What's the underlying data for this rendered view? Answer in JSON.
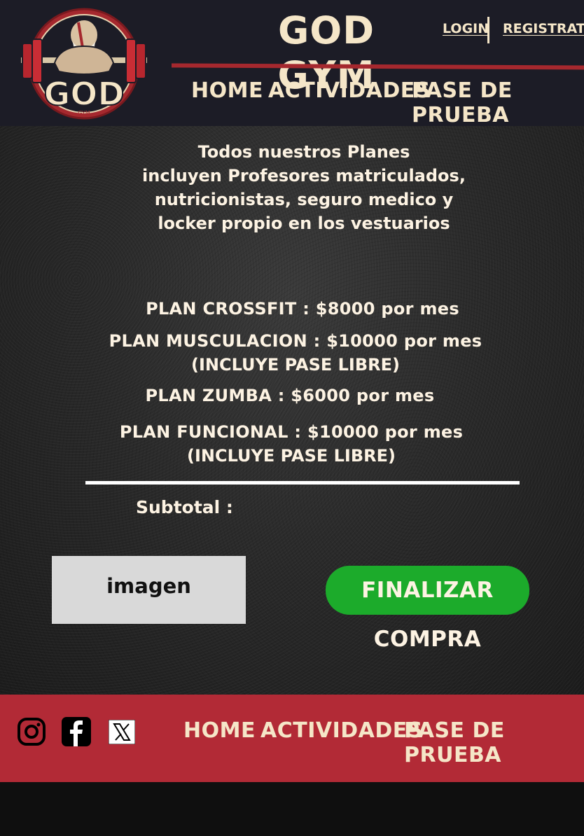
{
  "header": {
    "title": "GOD GYM",
    "logo_text": "GOD",
    "logo_subtext": "GYM",
    "login_label": "LOGIN",
    "register_label": "REGISTRATE",
    "nav": [
      {
        "label": "HOME"
      },
      {
        "label": "ACTIVIDADES"
      },
      {
        "label": "PASE DE PRUEBA"
      }
    ]
  },
  "main": {
    "intro_lines": [
      "Todos nuestros Planes",
      "incluyen Profesores matriculados,",
      "nutricionistas, seguro medico y",
      "locker propio en los vestuarios"
    ],
    "plans": [
      {
        "line1": "PLAN CROSSFIT : $8000 por mes",
        "line2": ""
      },
      {
        "line1": "PLAN MUSCULACION : $10000 por mes",
        "line2": "(INCLUYE PASE LIBRE)"
      },
      {
        "line1": "PLAN ZUMBA : $6000 por mes",
        "line2": ""
      },
      {
        "line1": "PLAN FUNCIONAL : $10000 por mes",
        "line2": "(INCLUYE PASE LIBRE)"
      }
    ],
    "subtotal_label": "Subtotal :",
    "image_placeholder": "imagen",
    "buy_button": "FINALIZAR COMPRA"
  },
  "footer": {
    "social": [
      {
        "icon": "instagram-icon"
      },
      {
        "icon": "facebook-icon"
      },
      {
        "icon": "x-twitter-icon"
      }
    ],
    "nav": [
      {
        "label": "HOME"
      },
      {
        "label": "ACTIVIDADES"
      },
      {
        "label": "PASE DE PRUEBA"
      }
    ]
  },
  "colors": {
    "header_bg": "#1c1c26",
    "accent_red": "#b22a36",
    "cream": "#f5e6c8",
    "buy_green": "#1cab2b"
  }
}
